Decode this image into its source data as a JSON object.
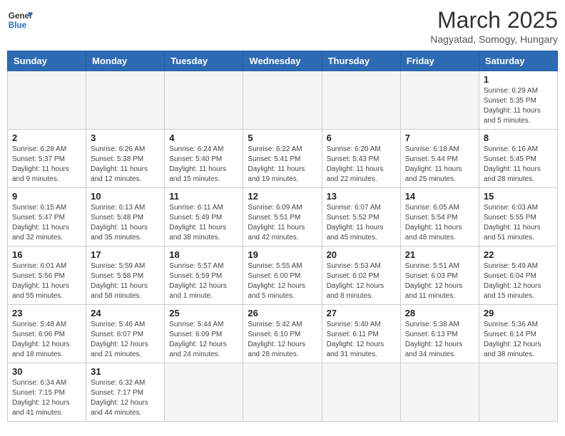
{
  "header": {
    "logo_general": "General",
    "logo_blue": "Blue",
    "month_title": "March 2025",
    "location": "Nagyatad, Somogy, Hungary"
  },
  "weekdays": [
    "Sunday",
    "Monday",
    "Tuesday",
    "Wednesday",
    "Thursday",
    "Friday",
    "Saturday"
  ],
  "days": [
    {
      "date": "",
      "info": ""
    },
    {
      "date": "",
      "info": ""
    },
    {
      "date": "",
      "info": ""
    },
    {
      "date": "",
      "info": ""
    },
    {
      "date": "",
      "info": ""
    },
    {
      "date": "",
      "info": ""
    },
    {
      "date": "1",
      "info": "Sunrise: 6:29 AM\nSunset: 5:35 PM\nDaylight: 11 hours\nand 5 minutes."
    },
    {
      "date": "2",
      "info": "Sunrise: 6:28 AM\nSunset: 5:37 PM\nDaylight: 11 hours\nand 9 minutes."
    },
    {
      "date": "3",
      "info": "Sunrise: 6:26 AM\nSunset: 5:38 PM\nDaylight: 11 hours\nand 12 minutes."
    },
    {
      "date": "4",
      "info": "Sunrise: 6:24 AM\nSunset: 5:40 PM\nDaylight: 11 hours\nand 15 minutes."
    },
    {
      "date": "5",
      "info": "Sunrise: 6:22 AM\nSunset: 5:41 PM\nDaylight: 11 hours\nand 19 minutes."
    },
    {
      "date": "6",
      "info": "Sunrise: 6:20 AM\nSunset: 5:43 PM\nDaylight: 11 hours\nand 22 minutes."
    },
    {
      "date": "7",
      "info": "Sunrise: 6:18 AM\nSunset: 5:44 PM\nDaylight: 11 hours\nand 25 minutes."
    },
    {
      "date": "8",
      "info": "Sunrise: 6:16 AM\nSunset: 5:45 PM\nDaylight: 11 hours\nand 28 minutes."
    },
    {
      "date": "9",
      "info": "Sunrise: 6:15 AM\nSunset: 5:47 PM\nDaylight: 11 hours\nand 32 minutes."
    },
    {
      "date": "10",
      "info": "Sunrise: 6:13 AM\nSunset: 5:48 PM\nDaylight: 11 hours\nand 35 minutes."
    },
    {
      "date": "11",
      "info": "Sunrise: 6:11 AM\nSunset: 5:49 PM\nDaylight: 11 hours\nand 38 minutes."
    },
    {
      "date": "12",
      "info": "Sunrise: 6:09 AM\nSunset: 5:51 PM\nDaylight: 11 hours\nand 42 minutes."
    },
    {
      "date": "13",
      "info": "Sunrise: 6:07 AM\nSunset: 5:52 PM\nDaylight: 11 hours\nand 45 minutes."
    },
    {
      "date": "14",
      "info": "Sunrise: 6:05 AM\nSunset: 5:54 PM\nDaylight: 11 hours\nand 48 minutes."
    },
    {
      "date": "15",
      "info": "Sunrise: 6:03 AM\nSunset: 5:55 PM\nDaylight: 11 hours\nand 51 minutes."
    },
    {
      "date": "16",
      "info": "Sunrise: 6:01 AM\nSunset: 5:56 PM\nDaylight: 11 hours\nand 55 minutes."
    },
    {
      "date": "17",
      "info": "Sunrise: 5:59 AM\nSunset: 5:58 PM\nDaylight: 11 hours\nand 58 minutes."
    },
    {
      "date": "18",
      "info": "Sunrise: 5:57 AM\nSunset: 5:59 PM\nDaylight: 12 hours\nand 1 minute."
    },
    {
      "date": "19",
      "info": "Sunrise: 5:55 AM\nSunset: 6:00 PM\nDaylight: 12 hours\nand 5 minutes."
    },
    {
      "date": "20",
      "info": "Sunrise: 5:53 AM\nSunset: 6:02 PM\nDaylight: 12 hours\nand 8 minutes."
    },
    {
      "date": "21",
      "info": "Sunrise: 5:51 AM\nSunset: 6:03 PM\nDaylight: 12 hours\nand 11 minutes."
    },
    {
      "date": "22",
      "info": "Sunrise: 5:49 AM\nSunset: 6:04 PM\nDaylight: 12 hours\nand 15 minutes."
    },
    {
      "date": "23",
      "info": "Sunrise: 5:48 AM\nSunset: 6:06 PM\nDaylight: 12 hours\nand 18 minutes."
    },
    {
      "date": "24",
      "info": "Sunrise: 5:46 AM\nSunset: 6:07 PM\nDaylight: 12 hours\nand 21 minutes."
    },
    {
      "date": "25",
      "info": "Sunrise: 5:44 AM\nSunset: 6:09 PM\nDaylight: 12 hours\nand 24 minutes."
    },
    {
      "date": "26",
      "info": "Sunrise: 5:42 AM\nSunset: 6:10 PM\nDaylight: 12 hours\nand 28 minutes."
    },
    {
      "date": "27",
      "info": "Sunrise: 5:40 AM\nSunset: 6:11 PM\nDaylight: 12 hours\nand 31 minutes."
    },
    {
      "date": "28",
      "info": "Sunrise: 5:38 AM\nSunset: 6:13 PM\nDaylight: 12 hours\nand 34 minutes."
    },
    {
      "date": "29",
      "info": "Sunrise: 5:36 AM\nSunset: 6:14 PM\nDaylight: 12 hours\nand 38 minutes."
    },
    {
      "date": "30",
      "info": "Sunrise: 6:34 AM\nSunset: 7:15 PM\nDaylight: 12 hours\nand 41 minutes."
    },
    {
      "date": "31",
      "info": "Sunrise: 6:32 AM\nSunset: 7:17 PM\nDaylight: 12 hours\nand 44 minutes."
    },
    {
      "date": "",
      "info": ""
    },
    {
      "date": "",
      "info": ""
    },
    {
      "date": "",
      "info": ""
    },
    {
      "date": "",
      "info": ""
    },
    {
      "date": "",
      "info": ""
    }
  ]
}
